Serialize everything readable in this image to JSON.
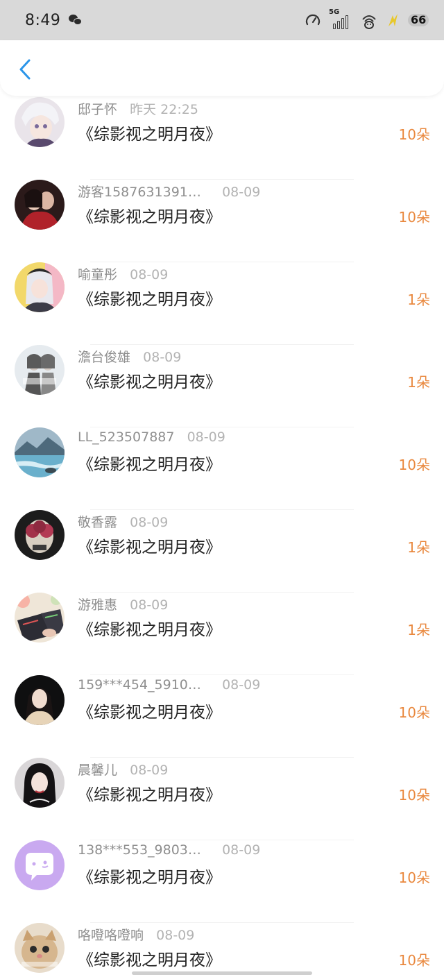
{
  "status_bar": {
    "time": "8:49",
    "network_label": "5G",
    "battery_level": "66",
    "icons": [
      "wechat-icon",
      "gauge-icon",
      "signal-5g-icon",
      "wifi-icon",
      "bolt-icon",
      "battery-icon"
    ]
  },
  "header": {
    "back_icon": "chevron-left-icon",
    "accent_color": "#2b95e9"
  },
  "colors": {
    "count": "#e9883e",
    "title": "#222222",
    "meta": "#9a9a9a"
  },
  "items": [
    {
      "username": "邸子怀",
      "date": "昨天 22:25",
      "title": "《综影视之明月夜》",
      "count": "10朵"
    },
    {
      "username": "游客1587631391…",
      "date": "08-09",
      "title": "《综影视之明月夜》",
      "count": "10朵"
    },
    {
      "username": "喻童彤",
      "date": "08-09",
      "title": "《综影视之明月夜》",
      "count": "1朵"
    },
    {
      "username": "澹台俊雄",
      "date": "08-09",
      "title": "《综影视之明月夜》",
      "count": "1朵"
    },
    {
      "username": "LL_523507887",
      "date": "08-09",
      "title": "《综影视之明月夜》",
      "count": "10朵"
    },
    {
      "username": "敬香露",
      "date": "08-09",
      "title": "《综影视之明月夜》",
      "count": "1朵"
    },
    {
      "username": "游雅惠",
      "date": "08-09",
      "title": "《综影视之明月夜》",
      "count": "1朵"
    },
    {
      "username": "159***454_5910…",
      "date": "08-09",
      "title": "《综影视之明月夜》",
      "count": "10朵"
    },
    {
      "username": "晨馨儿",
      "date": "08-09",
      "title": "《综影视之明月夜》",
      "count": "10朵"
    },
    {
      "username": "138***553_9803…",
      "date": "08-09",
      "title": "《综影视之明月夜》",
      "count": "10朵"
    },
    {
      "username": "咯噔咯噔响",
      "date": "08-09",
      "title": "《综影视之明月夜》",
      "count": "10朵"
    }
  ]
}
